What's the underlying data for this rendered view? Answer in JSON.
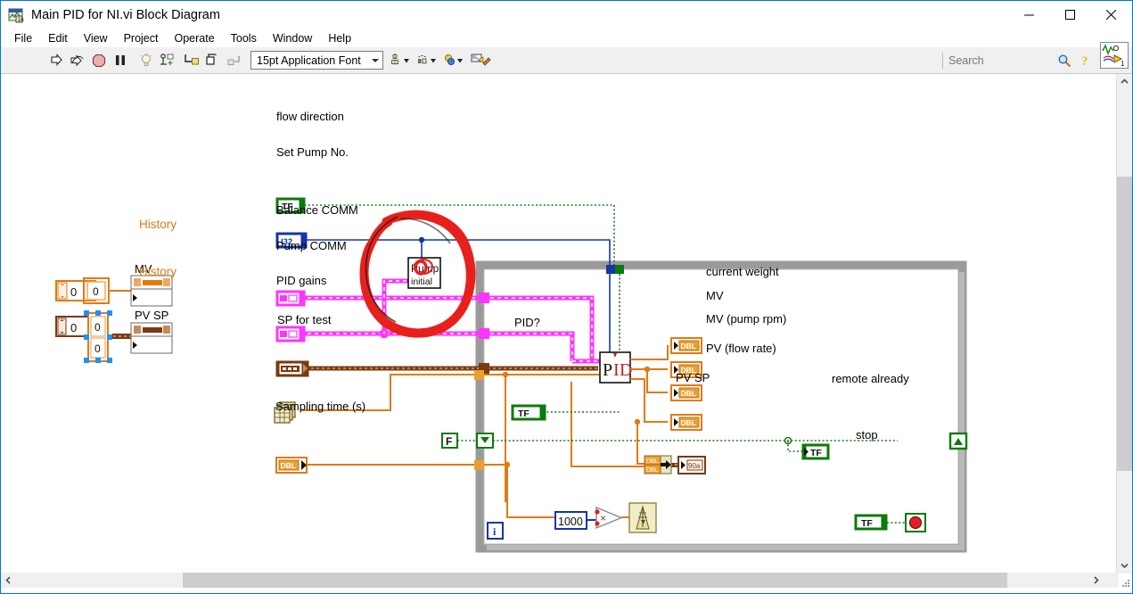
{
  "window": {
    "title": "Main PID for NI.vi Block Diagram",
    "app_icon": "labview-vi-icon",
    "controls": {
      "minimize": "—",
      "maximize": "□",
      "close": "✕"
    }
  },
  "menubar": {
    "items": [
      {
        "label": "File",
        "name": "menu-file"
      },
      {
        "label": "Edit",
        "name": "menu-edit"
      },
      {
        "label": "View",
        "name": "menu-view"
      },
      {
        "label": "Project",
        "name": "menu-project"
      },
      {
        "label": "Operate",
        "name": "menu-operate"
      },
      {
        "label": "Tools",
        "name": "menu-tools"
      },
      {
        "label": "Window",
        "name": "menu-window"
      },
      {
        "label": "Help",
        "name": "menu-help"
      }
    ]
  },
  "toolbar": {
    "buttons": [
      {
        "name": "run-button",
        "icon": "run-arrow-icon",
        "title": "Run"
      },
      {
        "name": "run-continuously-button",
        "icon": "run-continuously-icon",
        "title": "Run Continuously"
      },
      {
        "name": "abort-button",
        "icon": "abort-execution-icon",
        "title": "Abort Execution"
      },
      {
        "name": "pause-button",
        "icon": "pause-icon",
        "title": "Pause"
      },
      {
        "name": "highlight-execution-button",
        "icon": "lightbulb-icon",
        "title": "Highlight Execution"
      },
      {
        "name": "retain-wire-values-button",
        "icon": "retain-wire-values-icon",
        "title": "Retain Wire Values"
      },
      {
        "name": "step-into-button",
        "icon": "step-into-icon",
        "title": "Step Into"
      },
      {
        "name": "step-over-button",
        "icon": "step-over-icon",
        "title": "Step Over"
      },
      {
        "name": "step-out-button",
        "icon": "step-out-icon",
        "title": "Step Out"
      }
    ],
    "font_selector": {
      "name": "font-selector",
      "value": "15pt Application Font"
    },
    "align_buttons": [
      {
        "name": "align-objects-button",
        "icon": "align-objects-icon"
      },
      {
        "name": "distribute-objects-button",
        "icon": "distribute-objects-icon"
      },
      {
        "name": "reorder-button",
        "icon": "reorder-icon"
      },
      {
        "name": "clean-up-diagram-button",
        "icon": "clean-up-diagram-icon"
      }
    ],
    "search": {
      "name": "search-input",
      "placeholder": "Search",
      "value": ""
    },
    "search_icon": "magnifier-icon",
    "help_icon": "question-mark-help-icon",
    "vi_icon_badge": "1"
  },
  "diagram": {
    "left_constants": {
      "mv_numeric_value": "0",
      "mv_cluster_value": "0",
      "mv_label": "MV",
      "mv_history_label": "History",
      "pvsp_numeric_value": "0",
      "pvsp_cluster_value_1": "0",
      "pvsp_cluster_value_2": "0",
      "pvsp_label": "PV SP",
      "pvsp_history_label": "History"
    },
    "controls": [
      {
        "name": "terminal-flow-direction",
        "label": "flow direction",
        "type": "TF"
      },
      {
        "name": "terminal-set-pump-no",
        "label": "Set Pump No.",
        "type": "I32"
      },
      {
        "name": "terminal-balance-comm",
        "label": "Balance COMM",
        "type": "refnum"
      },
      {
        "name": "terminal-pump-comm",
        "label": "Pump COMM",
        "type": "refnum"
      },
      {
        "name": "terminal-pid-gains",
        "label": "PID gains",
        "type": "cluster"
      },
      {
        "name": "terminal-sp-for-test",
        "label": "SP for test",
        "type": "array"
      },
      {
        "name": "terminal-sampling-time",
        "label": "Sampling time (s)",
        "type": "DBL"
      }
    ],
    "subvi_pump_initial": {
      "name": "subvi-pump-initial",
      "icon_text_line1": "Pump",
      "icon_text_line2": "initial"
    },
    "subvi_pid": {
      "name": "subvi-pid",
      "icon_text": "PID"
    },
    "indicators": [
      {
        "name": "indicator-current-weight",
        "label": "current weight",
        "type": "DBL"
      },
      {
        "name": "indicator-mv",
        "label": "MV",
        "type": "DBL"
      },
      {
        "name": "indicator-mv-pump-rpm",
        "label": "MV (pump rpm)",
        "type": "DBL"
      },
      {
        "name": "indicator-pv-flow-rate",
        "label": "PV (flow rate)",
        "type": "DBL"
      },
      {
        "name": "indicator-pv-sp",
        "label": "PV SP",
        "type": "cluster"
      },
      {
        "name": "indicator-remote-already",
        "label": "remote already",
        "type": "TF"
      }
    ],
    "boolean_constant_false": {
      "name": "constant-false",
      "label": "F"
    },
    "pid_question": {
      "name": "terminal-pid-question",
      "label": "PID?",
      "type": "TF"
    },
    "stop_control": {
      "name": "terminal-stop",
      "label": "stop",
      "type": "TF"
    },
    "numeric_constant_1000": {
      "name": "constant-1000",
      "value": "1000"
    },
    "multiply_node": {
      "name": "multiply-function",
      "symbol": "×"
    },
    "wait_node": {
      "name": "wait-ms-function",
      "icon": "metronome-icon"
    },
    "iteration_terminal": {
      "name": "iteration-terminal",
      "label": "i"
    },
    "loop_condition_terminal": {
      "name": "loop-stop-condition-terminal",
      "icon": "stop-sign-icon"
    },
    "annotation": {
      "name": "red-circle-annotation",
      "color": "#e8201c",
      "describes": "Pump initial subVI"
    }
  },
  "colors": {
    "accent": "#0078d7",
    "wire_orange": "#e07b12",
    "wire_green": "#1f7a1f",
    "wire_pink": "#ff33ff",
    "wire_blue": "#1435a8",
    "wire_brown": "#7a3a12",
    "loop_gray": "#9a9a9a",
    "annotation_red": "#e8201c"
  },
  "scrollbars": {
    "vertical": {
      "name": "vertical-scrollbar",
      "up": "⌃",
      "down": "⌄"
    },
    "horizontal": {
      "name": "horizontal-scrollbar",
      "left": "‹",
      "right": "›"
    }
  }
}
